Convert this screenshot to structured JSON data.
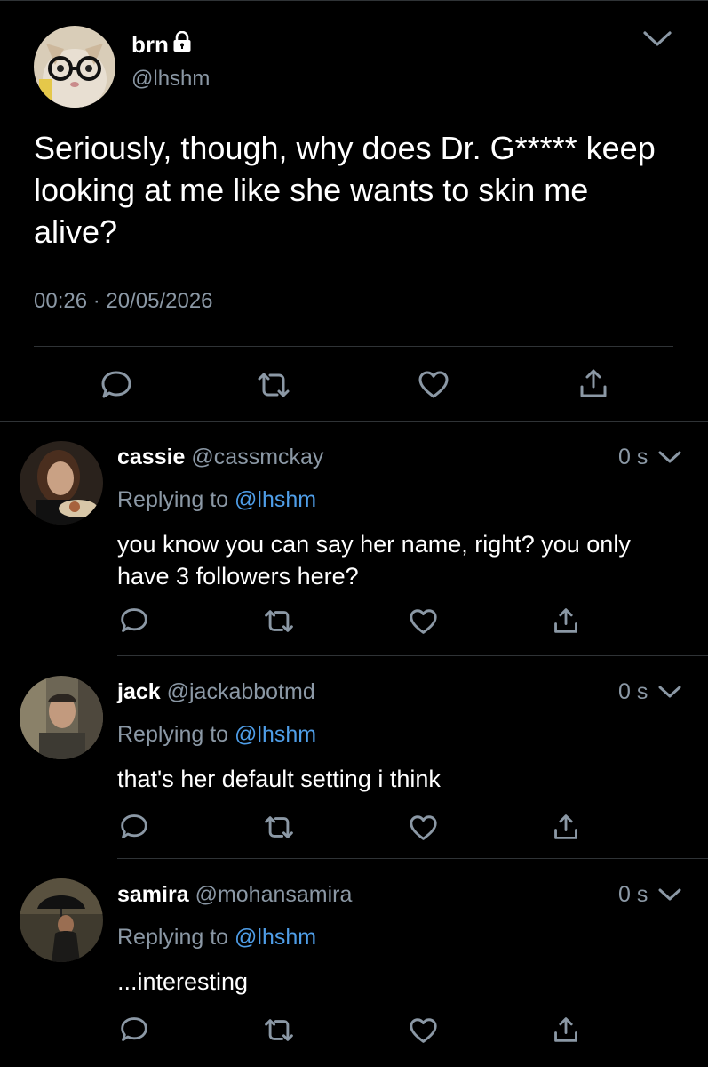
{
  "main_tweet": {
    "display_name": "brn",
    "handle": "@lhshm",
    "locked": true,
    "text": "Seriously, though, why does Dr. G***** keep looking at me like she wants to skin me alive?",
    "time": "00:26",
    "separator": "·",
    "date": "20/05/2026"
  },
  "replies": [
    {
      "display_name": "cassie",
      "handle": "@cassmckay",
      "time": "0 s",
      "replying_prefix": "Replying to",
      "replying_to": "@lhshm",
      "text": "you know you can say her name, right? you only have 3 followers here?"
    },
    {
      "display_name": "jack",
      "handle": "@jackabbotmd",
      "time": "0 s",
      "replying_prefix": "Replying to",
      "replying_to": "@lhshm",
      "text": "that's her default setting i think"
    },
    {
      "display_name": "samira",
      "handle": "@mohansamira",
      "time": "0 s",
      "replying_prefix": "Replying to",
      "replying_to": "@lhshm",
      "text": "...interesting"
    }
  ],
  "colors": {
    "background": "#000000",
    "text": "#ffffff",
    "secondary": "#8b98a5",
    "mention": "#4f9ee8",
    "divider": "#2f3336"
  },
  "icons": [
    "lock-icon",
    "chevron-down-icon",
    "reply-icon",
    "retweet-icon",
    "like-icon",
    "share-icon"
  ]
}
